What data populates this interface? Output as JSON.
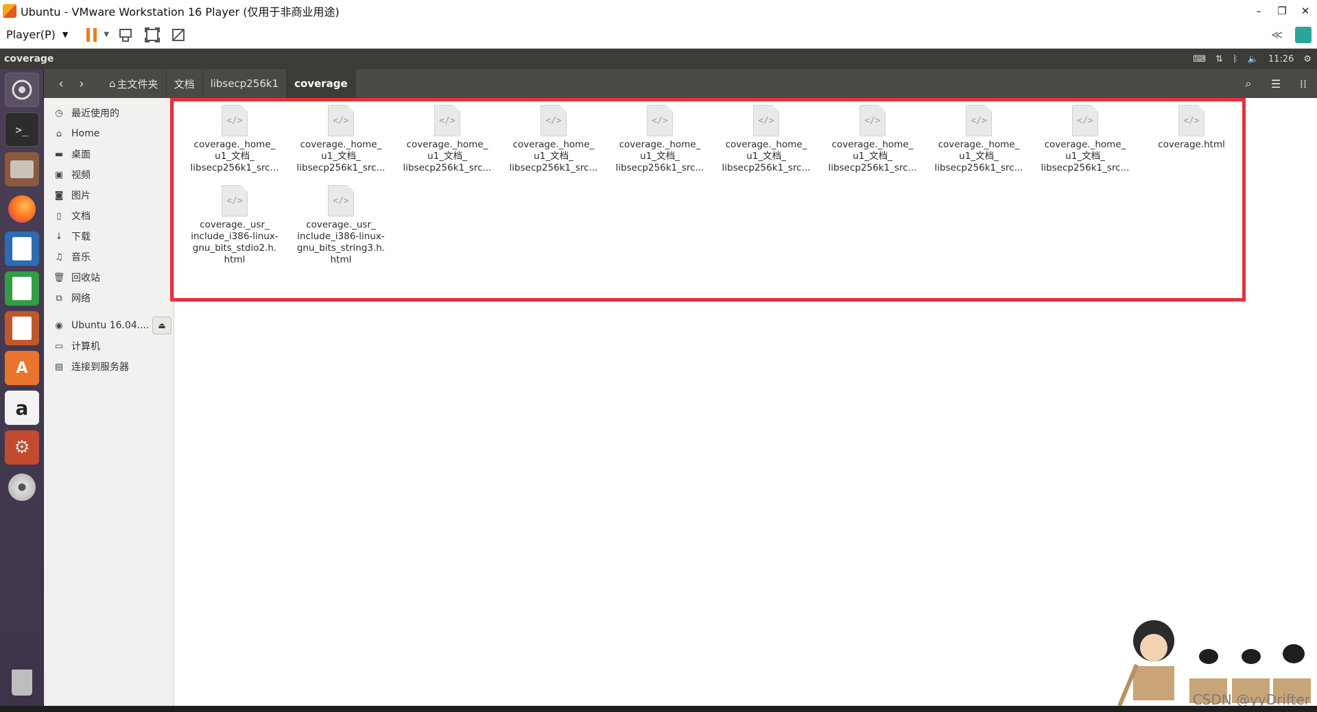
{
  "vm": {
    "title": "Ubuntu - VMware Workstation 16 Player (仅用于非商业用途)",
    "player_menu": "Player(P)"
  },
  "top_panel": {
    "app_name": "coverage",
    "time": "11:26"
  },
  "header": {
    "breadcrumbs": [
      "主文件夹",
      "文档",
      "libsecp256k1",
      "coverage"
    ]
  },
  "sidebar": {
    "items": [
      {
        "icon": "clock-icon",
        "label": "最近使用的"
      },
      {
        "icon": "home-icon",
        "label": "Home"
      },
      {
        "icon": "folder-icon",
        "label": "桌面"
      },
      {
        "icon": "video-icon",
        "label": "视频"
      },
      {
        "icon": "camera-icon",
        "label": "图片"
      },
      {
        "icon": "document-icon",
        "label": "文档"
      },
      {
        "icon": "download-icon",
        "label": "下载"
      },
      {
        "icon": "music-icon",
        "label": "音乐"
      },
      {
        "icon": "trash-icon",
        "label": "回收站"
      },
      {
        "icon": "network-icon",
        "label": "网络"
      }
    ],
    "devices": [
      {
        "icon": "disc-icon",
        "label": "Ubuntu 16.04...."
      },
      {
        "icon": "computer-icon",
        "label": "计算机"
      },
      {
        "icon": "server-icon",
        "label": "连接到服务器"
      }
    ]
  },
  "files": [
    {
      "line1": "coverage._home_",
      "line2": "u1_文档_",
      "line3": "libsecp256k1_src..."
    },
    {
      "line1": "coverage._home_",
      "line2": "u1_文档_",
      "line3": "libsecp256k1_src..."
    },
    {
      "line1": "coverage._home_",
      "line2": "u1_文档_",
      "line3": "libsecp256k1_src..."
    },
    {
      "line1": "coverage._home_",
      "line2": "u1_文档_",
      "line3": "libsecp256k1_src..."
    },
    {
      "line1": "coverage._home_",
      "line2": "u1_文档_",
      "line3": "libsecp256k1_src..."
    },
    {
      "line1": "coverage._home_",
      "line2": "u1_文档_",
      "line3": "libsecp256k1_src..."
    },
    {
      "line1": "coverage._home_",
      "line2": "u1_文档_",
      "line3": "libsecp256k1_src..."
    },
    {
      "line1": "coverage._home_",
      "line2": "u1_文档_",
      "line3": "libsecp256k1_src..."
    },
    {
      "line1": "coverage._home_",
      "line2": "u1_文档_",
      "line3": "libsecp256k1_src..."
    },
    {
      "line1": "coverage.html",
      "line2": "",
      "line3": ""
    },
    {
      "line1": "coverage._usr_",
      "line2": "include_i386-linux-",
      "line3": "gnu_bits_stdio2.h.",
      "line4": "html"
    },
    {
      "line1": "coverage._usr_",
      "line2": "include_i386-linux-",
      "line3": "gnu_bits_string3.h.",
      "line4": "html"
    }
  ],
  "watermark": "CSDN @yyDrifter"
}
